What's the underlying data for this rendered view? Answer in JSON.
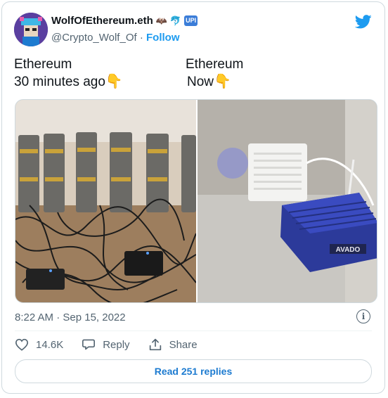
{
  "tweet": {
    "display_name": "WolfOfEthereum.eth",
    "handle": "@Crypto_Wolf_Of",
    "separator": "·",
    "follow_label": "Follow",
    "badge_label": "UPI",
    "text_left_line1": "Ethereum",
    "text_left_line2": "30 minutes ago",
    "text_right_line1": "Ethereum",
    "text_right_line2": "Now",
    "timestamp": "8:22 AM · Sep 15, 2022",
    "likes": "14.6K",
    "reply_label": "Reply",
    "share_label": "Share",
    "read_replies_label": "Read 251 replies",
    "info_glyph": "i"
  },
  "icons": {
    "twitter_bird": "twitter-bird-icon",
    "heart": "heart-icon",
    "reply": "reply-bubble-icon",
    "share": "share-icon",
    "info": "info-icon",
    "pointing_down": "pointing-down-emoji"
  },
  "colors": {
    "accent": "#1d9bf0",
    "text": "#0f1419",
    "muted": "#536471",
    "border": "#cfd9de"
  }
}
